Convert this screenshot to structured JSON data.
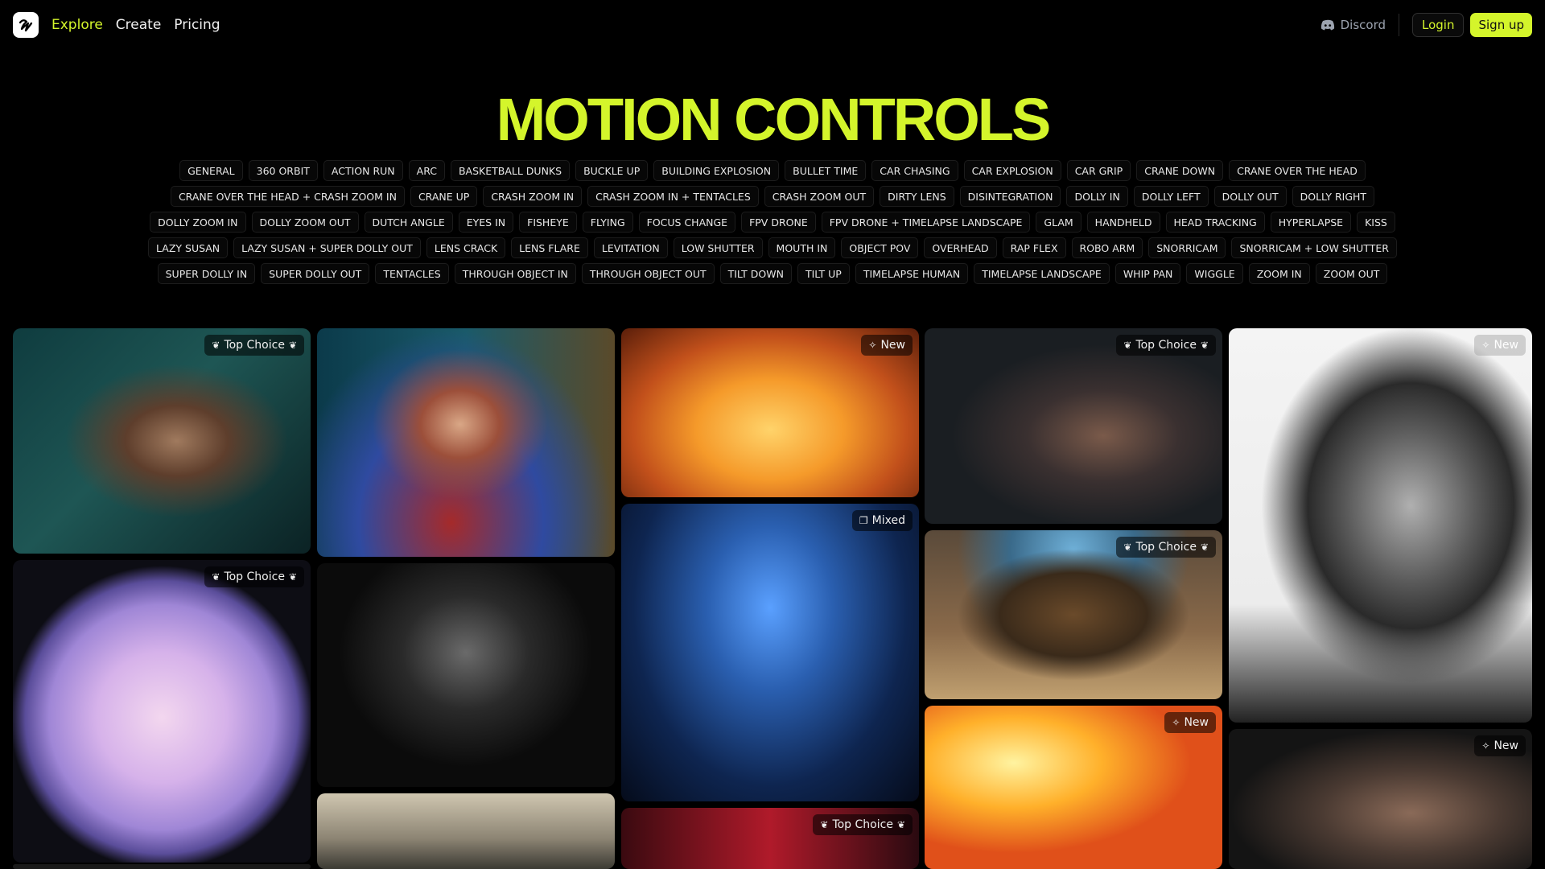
{
  "nav": {
    "explore": "Explore",
    "create": "Create",
    "pricing": "Pricing",
    "discord": "Discord",
    "login": "Login",
    "signup": "Sign up"
  },
  "title": "MOTION CONTROLS",
  "accent_color": "#d4f52b",
  "tag_rows": [
    [
      "GENERAL",
      "360 ORBIT",
      "ACTION RUN",
      "ARC",
      "BASKETBALL DUNKS",
      "BUCKLE UP",
      "BUILDING EXPLOSION",
      "BULLET TIME",
      "CAR CHASING",
      "CAR EXPLOSION",
      "CAR GRIP",
      "CRANE DOWN",
      "CRANE OVER THE HEAD"
    ],
    [
      "CRANE OVER THE HEAD + CRASH ZOOM IN",
      "CRANE UP",
      "CRASH ZOOM IN",
      "CRASH ZOOM IN + TENTACLES",
      "CRASH ZOOM OUT",
      "DIRTY LENS",
      "DISINTEGRATION",
      "DOLLY IN",
      "DOLLY LEFT",
      "DOLLY OUT",
      "DOLLY RIGHT"
    ],
    [
      "DOLLY ZOOM IN",
      "DOLLY ZOOM OUT",
      "DUTCH ANGLE",
      "EYES IN",
      "FISHEYE",
      "FLYING",
      "FOCUS CHANGE",
      "FPV DRONE",
      "FPV DRONE + TIMELAPSE LANDSCAPE",
      "GLAM",
      "HANDHELD",
      "HEAD TRACKING",
      "HYPERLAPSE",
      "KISS"
    ],
    [
      "LAZY SUSAN",
      "LAZY SUSAN + SUPER DOLLY OUT",
      "LENS CRACK",
      "LENS FLARE",
      "LEVITATION",
      "LOW SHUTTER",
      "MOUTH IN",
      "OBJECT POV",
      "OVERHEAD",
      "RAP FLEX",
      "ROBO ARM",
      "SNORRICAM",
      "SNORRICAM + LOW SHUTTER"
    ],
    [
      "SUPER DOLLY IN",
      "SUPER DOLLY OUT",
      "TENTACLES",
      "THROUGH OBJECT IN",
      "THROUGH OBJECT OUT",
      "TILT DOWN",
      "TILT UP",
      "TIMELAPSE HUMAN",
      "TIMELAPSE LANDSCAPE",
      "WHIP PAN",
      "WIGGLE",
      "ZOOM IN",
      "ZOOM OUT"
    ]
  ],
  "badges": {
    "top_choice": "Top Choice",
    "new": "New",
    "mixed": "Mixed"
  }
}
